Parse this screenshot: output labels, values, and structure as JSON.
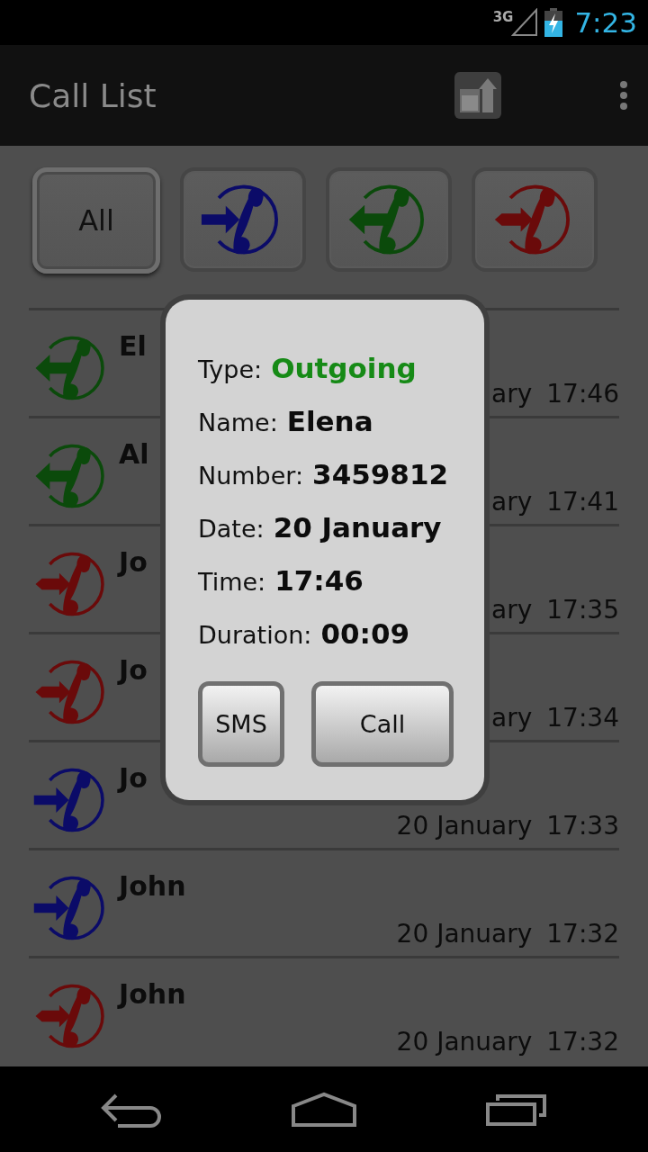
{
  "status_bar": {
    "network": "3G",
    "time": "7:23"
  },
  "action_bar": {
    "title": "Call List"
  },
  "filters": [
    {
      "kind": "all",
      "label": "All",
      "selected": true
    },
    {
      "kind": "incoming",
      "selected": false
    },
    {
      "kind": "outgoing",
      "selected": false
    },
    {
      "kind": "missed",
      "selected": false
    }
  ],
  "calls": [
    {
      "kind": "outgoing",
      "name": "El",
      "date": "ary",
      "time": "17:46"
    },
    {
      "kind": "outgoing",
      "name": "Al",
      "date": "ary",
      "time": "17:41"
    },
    {
      "kind": "missed",
      "name": "Jo",
      "date": "ary",
      "time": "17:35"
    },
    {
      "kind": "missed",
      "name": "Jo",
      "date": "ary",
      "time": "17:34"
    },
    {
      "kind": "incoming",
      "name": "Jo",
      "date": "20 January",
      "time": "17:33"
    },
    {
      "kind": "incoming",
      "name": "John",
      "date": "20 January",
      "time": "17:32"
    },
    {
      "kind": "missed",
      "name": "John",
      "date": "20 January",
      "time": "17:32"
    }
  ],
  "dialog": {
    "fields": [
      {
        "label": "Type:",
        "value": "Outgoing",
        "color": "#168a16"
      },
      {
        "label": "Name:",
        "value": "Elena"
      },
      {
        "label": "Number:",
        "value": "3459812"
      },
      {
        "label": "Date:",
        "value": "20 January"
      },
      {
        "label": "Time:",
        "value": "17:46"
      },
      {
        "label": "Duration:",
        "value": "00:09"
      }
    ],
    "buttons": [
      "SMS",
      "Call"
    ]
  }
}
